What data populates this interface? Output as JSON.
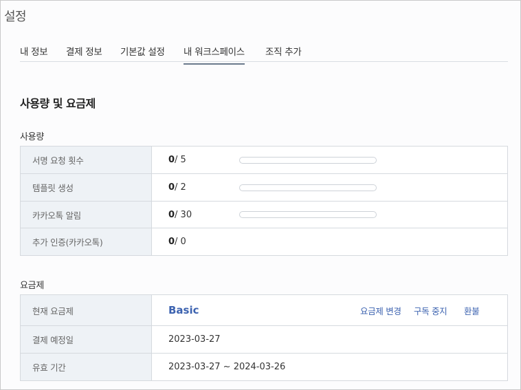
{
  "page": {
    "title": "설정"
  },
  "tabs": [
    {
      "label": "내 정보",
      "active": false
    },
    {
      "label": "결제 정보",
      "active": false
    },
    {
      "label": "기본값 설정",
      "active": false
    },
    {
      "label": "내 워크스페이스",
      "active": true
    },
    {
      "label": "조직 추가",
      "active": false
    }
  ],
  "section": {
    "title": "사용량 및 요금제"
  },
  "usage": {
    "title": "사용량",
    "rows": [
      {
        "label": "서명 요청 횟수",
        "used": "0",
        "limit": " / 5",
        "progress": 0
      },
      {
        "label": "템플릿 생성",
        "used": "0",
        "limit": " / 2",
        "progress": 0
      },
      {
        "label": "카카오톡 알림",
        "used": "0",
        "limit": " / 30",
        "progress": 0
      },
      {
        "label": "추가 인증(카카오톡)",
        "used": "0",
        "limit": " / 0"
      }
    ]
  },
  "plan": {
    "title": "요금제",
    "current_label": "현재 요금제",
    "current_value": "Basic",
    "change_link": "요금제 변경",
    "cancel_link": "구독 중지",
    "refund_link": "환불",
    "payment_label": "결제 예정일",
    "payment_value": "2023-03-27",
    "period_label": "유효 기간",
    "period_value": "2023-03-27 ~ 2024-03-26"
  },
  "colors": {
    "accent": "#3d63b0",
    "header_bg": "#eef2f6",
    "border": "#d5d9de"
  }
}
